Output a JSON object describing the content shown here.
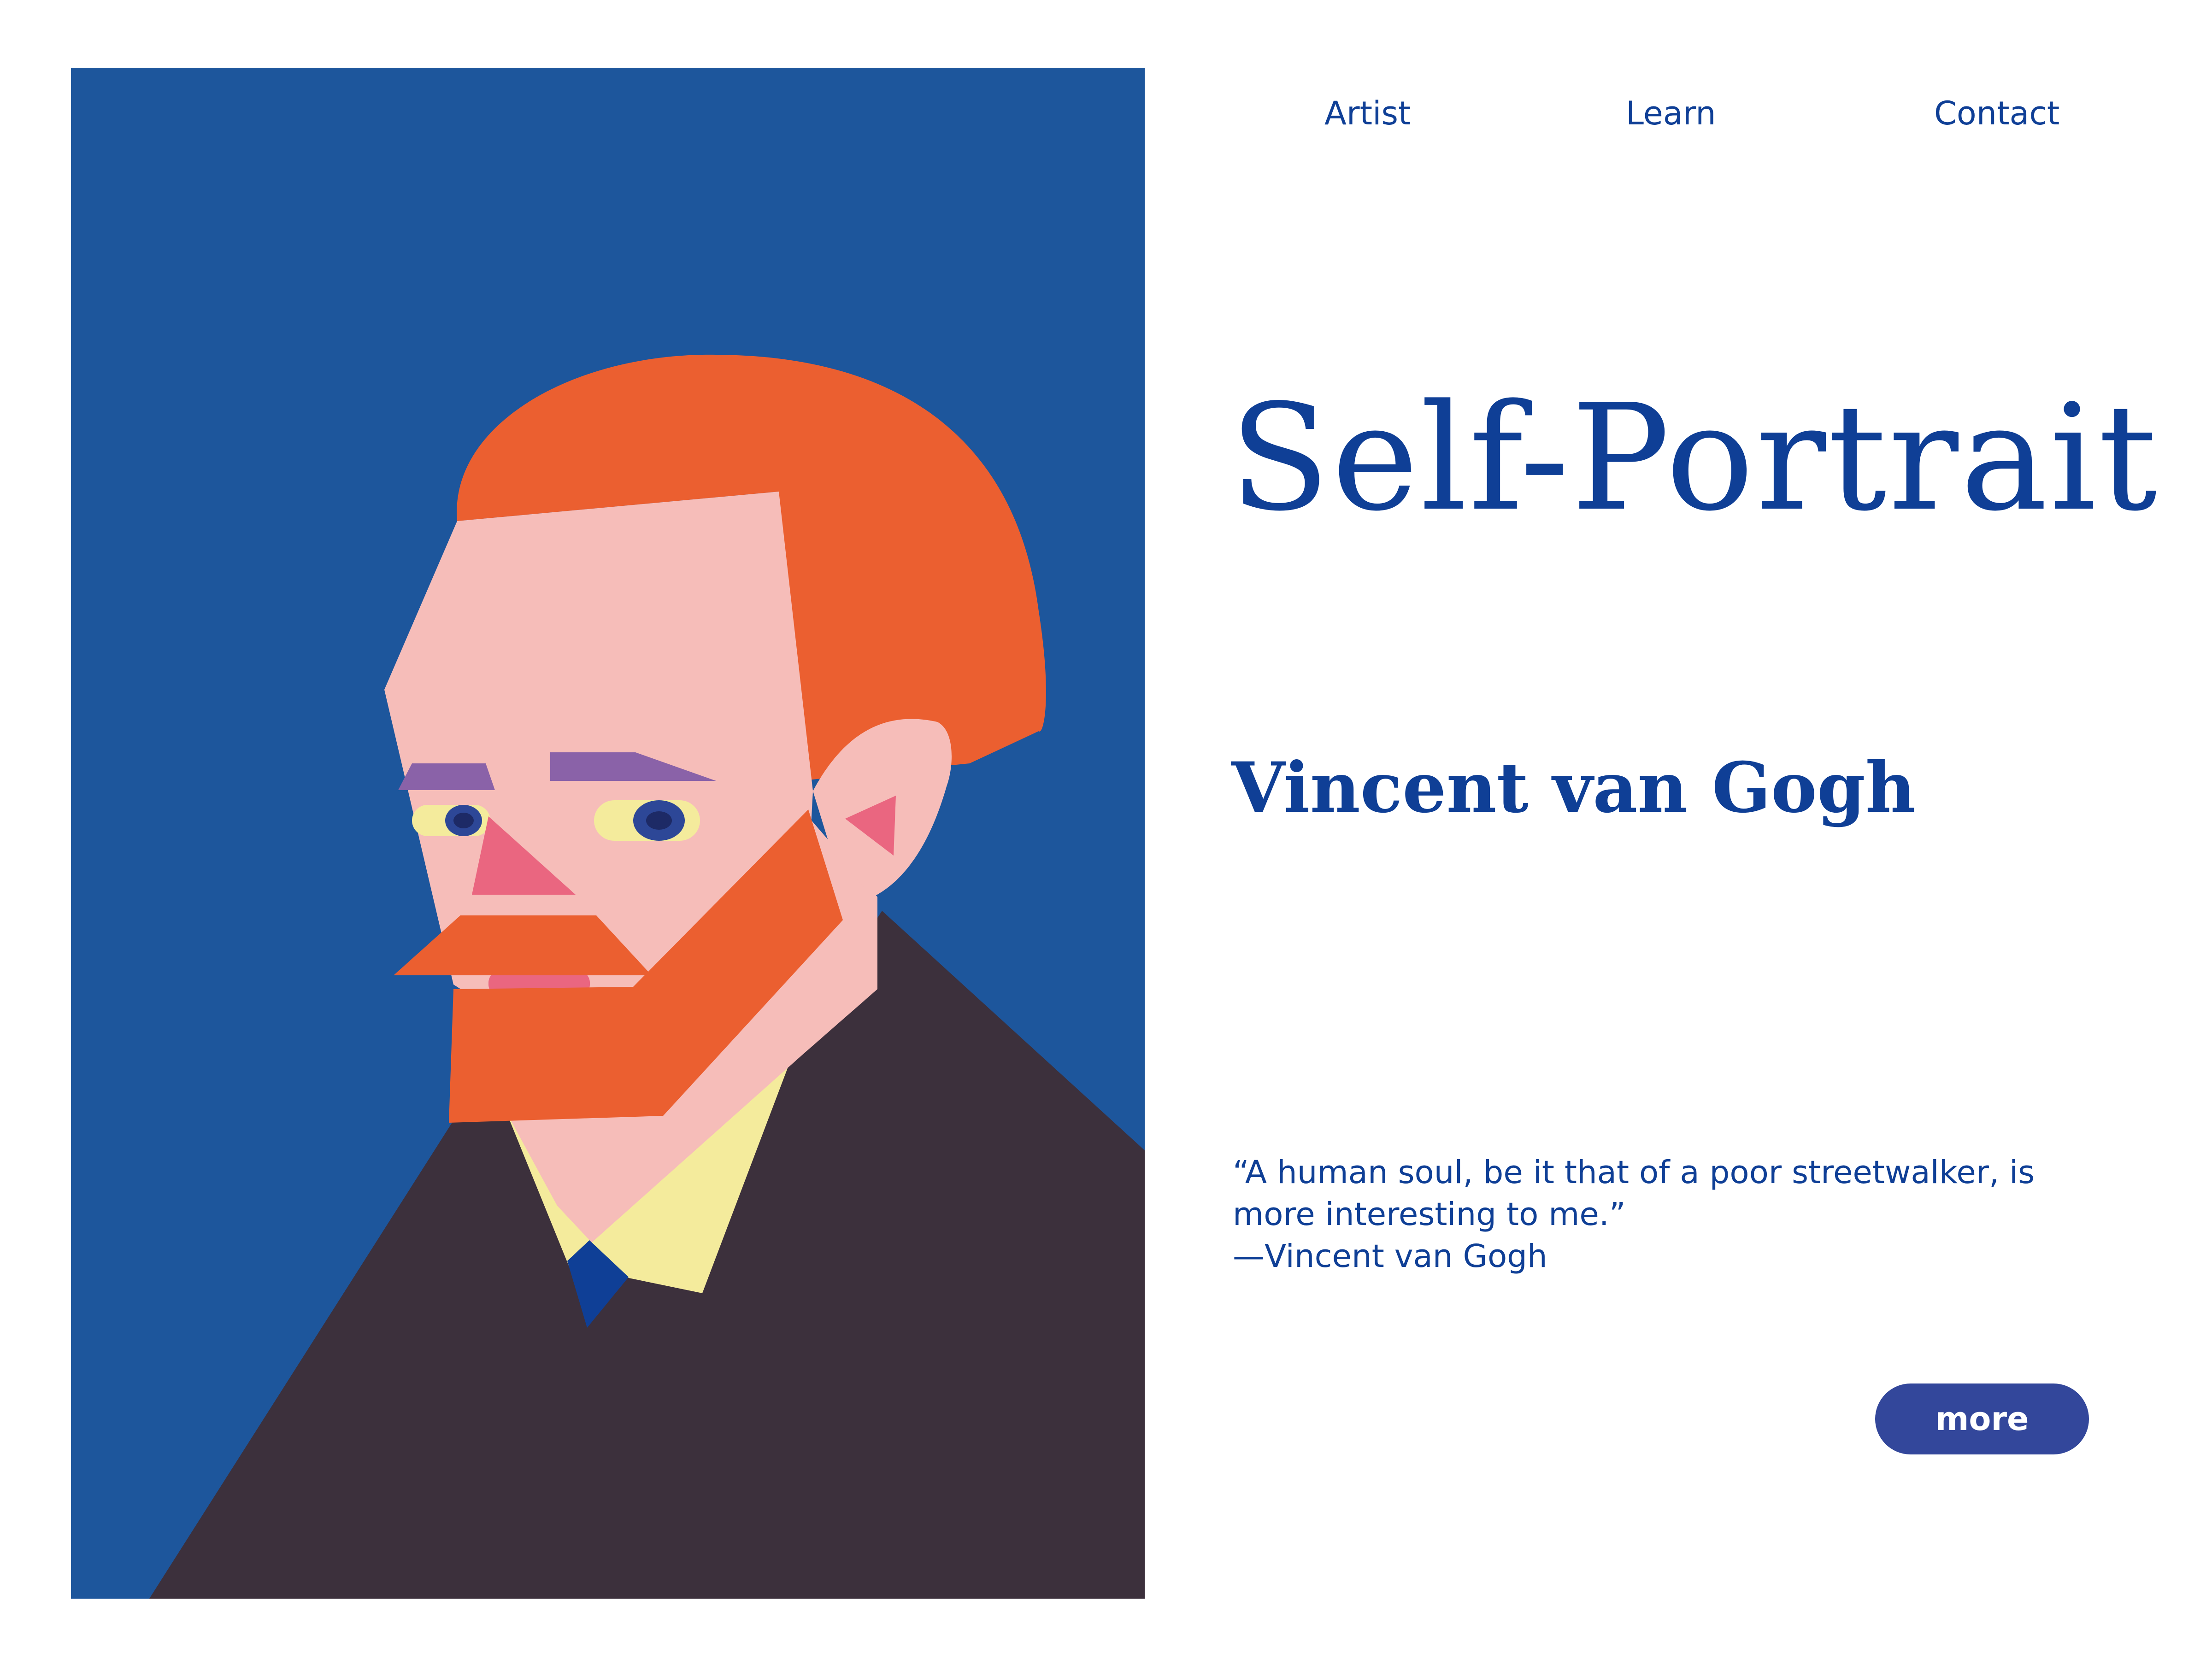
{
  "nav": {
    "items": [
      {
        "label": "Artist"
      },
      {
        "label": "Learn"
      },
      {
        "label": "Contact"
      }
    ]
  },
  "hero": {
    "title": "Self-Portrait",
    "artist": "Vincent van Gogh"
  },
  "quote": {
    "line1": "“A human soul, be it that of a poor streetwalker, is",
    "line2": "more interesting to me.”",
    "attribution": "—Vincent van Gogh"
  },
  "cta": {
    "label": "more"
  },
  "colors": {
    "background": "#1d569c",
    "hair": "#eb5f30",
    "skin": "#f6bdb9",
    "nose": "#ea6680",
    "brow": "#8a62a8",
    "eye_white": "#f4eb9c",
    "iris": "#2d4797",
    "coat": "#3c303c",
    "shirt": "#f4eb9c",
    "tie": "#0f3f96",
    "text": "#0f3f96",
    "button": "#33479b"
  }
}
